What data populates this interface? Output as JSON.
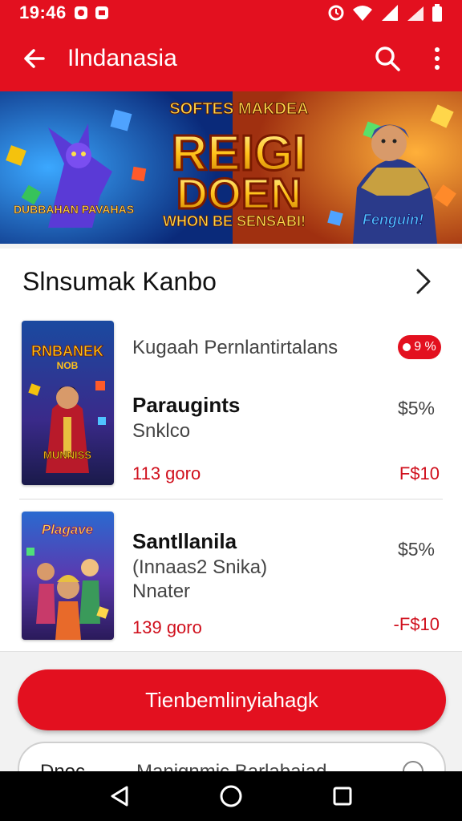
{
  "status": {
    "time": "19:46"
  },
  "app_bar": {
    "title": "Ilndanasia"
  },
  "banner": {
    "top_text": "SOFTES MAKDEA",
    "main_line1": "REIGI",
    "main_line2": "DOEN",
    "sub_text": "WHON BE SENSABI!",
    "left_logo": "DUBBAHAN PAVAHAS",
    "right_logo": "Fenguin!"
  },
  "section": {
    "title": "Slnsumak Kanbo"
  },
  "items": [
    {
      "publisher": "Kugaah Pernlantirtalans",
      "badge": "9 %",
      "title": "Paraugints",
      "subtitle": "Snklco",
      "size": "113 goro",
      "price_old": "$5%",
      "price_new": "F$10",
      "thumb_text_top": "RNBANEK",
      "thumb_text_mid": "NOB",
      "thumb_text_bottom": "MUNNISS"
    },
    {
      "publisher": "",
      "title": "Santllanila",
      "subtitle": "(Innaas2 Snika)",
      "subtitle2": "Nnater",
      "size": "139 goro",
      "price_old": "$5%",
      "price_new": "-F$10",
      "thumb_text_top": "Plagave"
    }
  ],
  "primary_button": {
    "label": "Tienbemlinyiahagk"
  },
  "option": {
    "left": "Dnoc",
    "right": "Manignmic Barlabaiad"
  },
  "colors": {
    "accent": "#e3101f",
    "price_red": "#d0101d"
  }
}
